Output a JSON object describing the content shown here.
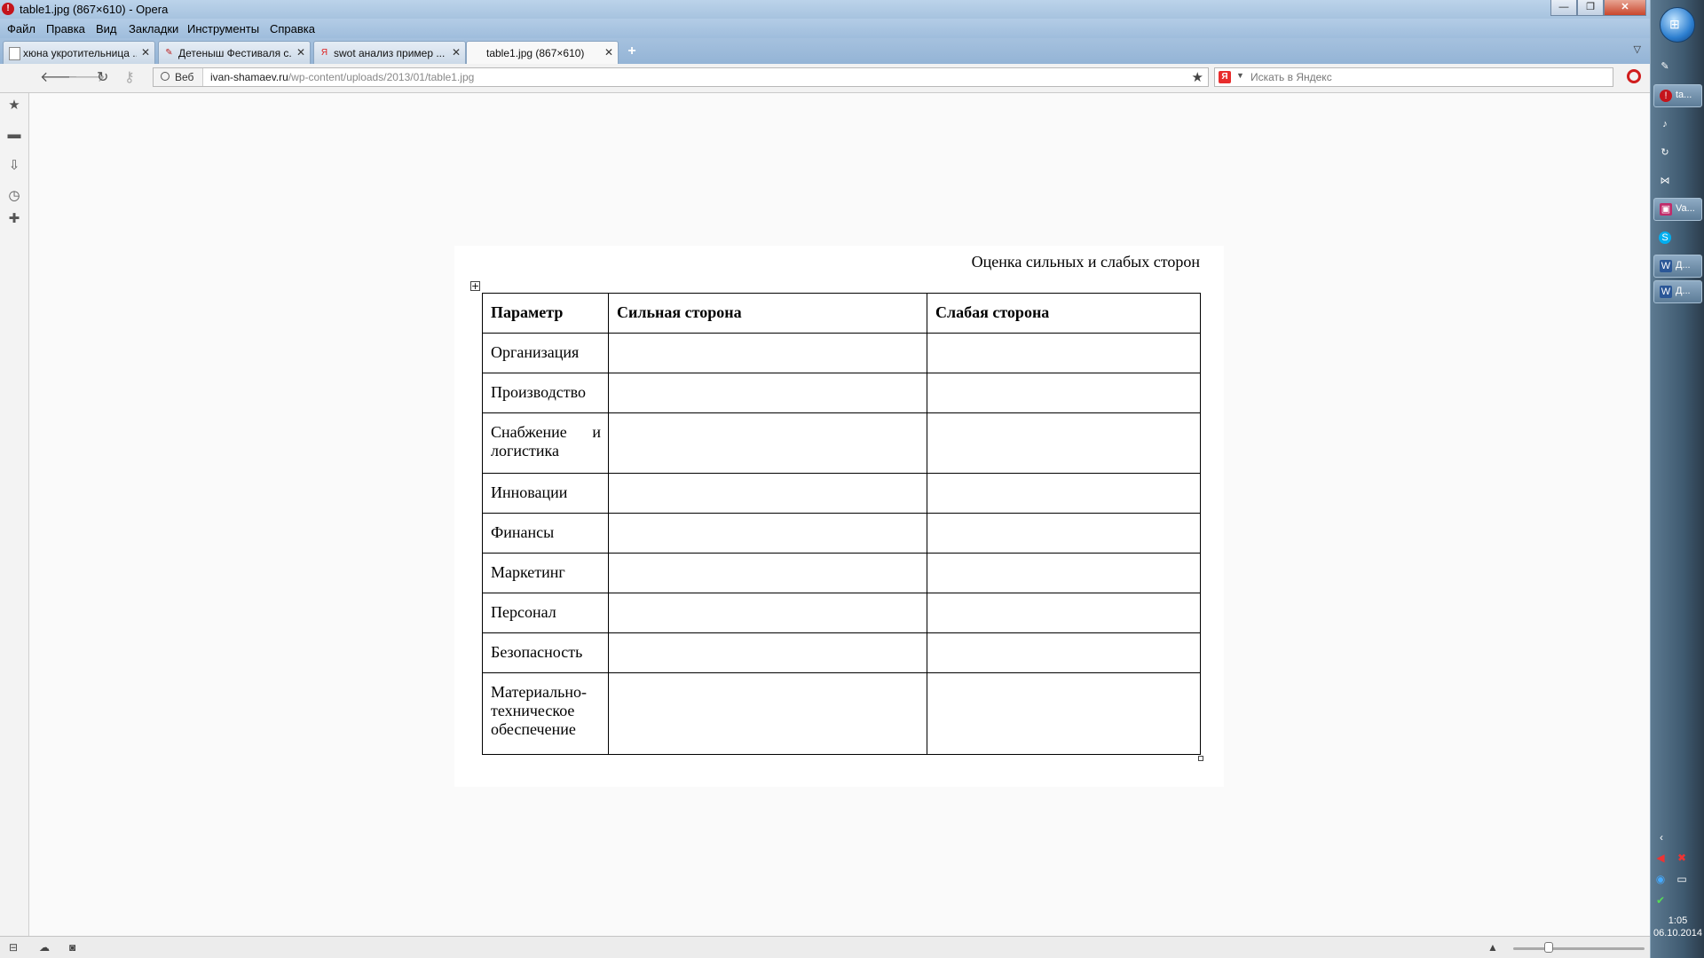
{
  "window": {
    "title": "table1.jpg (867×610) - Opera",
    "minimize_glyph": "—",
    "restore_glyph": "❐",
    "close_glyph": "✕"
  },
  "menu": [
    "Файл",
    "Правка",
    "Вид",
    "Закладки",
    "Инструменты",
    "Справка"
  ],
  "tabs": [
    {
      "label": "хюна укротительница ...",
      "icon": "page-icon",
      "active": false
    },
    {
      "label": "Детеныш Фестиваля с...",
      "icon": "site-favicon",
      "active": false
    },
    {
      "label": "swot анализ пример ...",
      "icon": "yandex-icon",
      "active": false
    },
    {
      "label": "table1.jpg (867×610)",
      "icon": "image-icon",
      "active": true
    }
  ],
  "address": {
    "badge": "Веб",
    "url_domain": "ivan-shamaev.ru",
    "url_path": "/wp-content/uploads/2013/01/table1.jpg"
  },
  "search": {
    "placeholder": "Искать в Яндекс",
    "engine_glyph": "Я"
  },
  "document": {
    "title": "Оценка сильных и слабых сторон",
    "headers": [
      "Параметр",
      "Сильная сторона",
      "Слабая сторона"
    ],
    "rows": [
      "Организация",
      "Производство",
      "Снабжение и логистика",
      "Инновации",
      "Финансы",
      "Маркетинг",
      "Персонал",
      "Безопасность",
      "Материально-техническое обеспечение"
    ]
  },
  "taskbar": {
    "items": [
      {
        "label": "ta...",
        "icon": "opera-icon",
        "color": "#c4141b"
      },
      {
        "label": "Va...",
        "icon": "save-icon",
        "color": "#c02b6a"
      },
      {
        "label": "Д...",
        "icon": "word-document-icon",
        "color": "#2b5797"
      },
      {
        "label": "Д...",
        "icon": "word-document-icon",
        "color": "#2b5797"
      }
    ],
    "clock_time": "1:05",
    "clock_date": "06.10.2014"
  }
}
